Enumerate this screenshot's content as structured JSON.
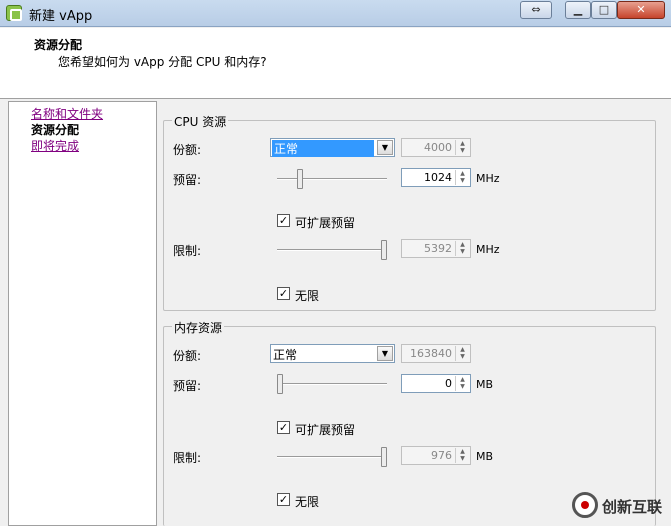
{
  "window": {
    "title": "新建 vApp",
    "restore_glyph": "⇔",
    "min_glyph": "▁",
    "max_glyph": "□",
    "close_glyph": "✕"
  },
  "header": {
    "title": "资源分配",
    "subtitle": "您希望如何为 vApp 分配 CPU 和内存?"
  },
  "nav": {
    "items": [
      {
        "label": "名称和文件夹",
        "state": "link"
      },
      {
        "label": "资源分配",
        "state": "current"
      },
      {
        "label": "即将完成",
        "state": "link"
      }
    ]
  },
  "cpu": {
    "title": "CPU 资源",
    "shares_label": "份额:",
    "shares_selected": "正常",
    "shares_value": "4000",
    "reservation_label": "预留:",
    "reservation_value": "1024",
    "reservation_unit": "MHz",
    "reservation_slider_fraction": 0.19,
    "expandable_label": "可扩展预留",
    "expandable_checked": true,
    "limit_label": "限制:",
    "limit_value": "5392",
    "limit_unit": "MHz",
    "limit_slider_fraction": 1.0,
    "unlimited_label": "无限",
    "unlimited_checked": true
  },
  "memory": {
    "title": "内存资源",
    "shares_label": "份额:",
    "shares_selected": "正常",
    "shares_value": "163840",
    "reservation_label": "预留:",
    "reservation_value": "0",
    "reservation_unit": "MB",
    "reservation_slider_fraction": 0.0,
    "expandable_label": "可扩展预留",
    "expandable_checked": true,
    "limit_label": "限制:",
    "limit_value": "976",
    "limit_unit": "MB",
    "limit_slider_fraction": 1.0,
    "unlimited_label": "无限",
    "unlimited_checked": true
  },
  "watermark": {
    "text": "创新互联"
  },
  "glyphs": {
    "check": "✓",
    "dropdown": "▼",
    "spin_up": "▲",
    "spin_down": "▼"
  }
}
